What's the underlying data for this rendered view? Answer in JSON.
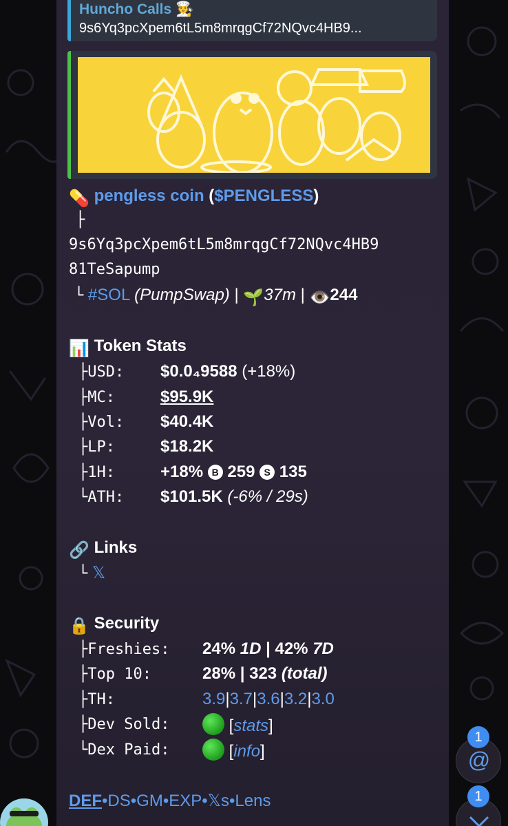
{
  "reply": {
    "sender": "Huncho Calls",
    "sender_emoji": "🧑‍🍳",
    "text": "9s6Yq3pcXpem6tL5m8mrqgCf72NQvc4HB9..."
  },
  "token": {
    "pill_emoji": "💊",
    "name": "pengless coin",
    "paren_open": " (",
    "ticker": "$PENGLESS",
    "paren_close": ")",
    "branch1": "├",
    "address_line1": "9s6Yq3pcXpem6tL5m8mrqgCf72NQvc4HB9",
    "address_line2": "81TeSapump",
    "branch2": "└",
    "chain": "#SOL",
    "dex": "(PumpSwap)",
    "sep": "|",
    "age_emoji": "🌱",
    "age": "37m",
    "views_emoji": "👁️",
    "views": "244"
  },
  "stats": {
    "emoji": "📊",
    "title": "Token Stats",
    "usd_label": "├USD:",
    "usd_value": "$0.0₄9588",
    "usd_change": "(+18%)",
    "mc_label": "├MC:",
    "mc_value": "$95.9K",
    "vol_label": "├Vol:",
    "vol_value": "$40.4K",
    "lp_label": "├LP:",
    "lp_value": "$18.2K",
    "h1_label": "├1H:",
    "h1_change": "+18%",
    "h1_buy_icon": "B",
    "h1_buys": "259",
    "h1_sell_icon": "S",
    "h1_sells": "135",
    "ath_label": "└ATH:",
    "ath_value": "$101.5K",
    "ath_detail": "(-6% / 29s)"
  },
  "links": {
    "emoji": "🔗",
    "title": "Links",
    "branch": "└",
    "x_link": "𝕏"
  },
  "security": {
    "emoji": "🔒",
    "title": "Security",
    "freshies_label": "├Freshies:",
    "freshies_1d": "24%",
    "freshies_1d_unit": "1D",
    "freshies_sep": "|",
    "freshies_7d": "42%",
    "freshies_7d_unit": "7D",
    "top10_label": "├Top 10:",
    "top10_pct": "28%",
    "top10_sep": "|",
    "top10_count": "323",
    "top10_note": "(total)",
    "th_label": "├TH:",
    "th_values": [
      "3.9",
      "3.7",
      "3.6",
      "3.2",
      "3.0"
    ],
    "th_sep": "|",
    "dev_label": "├Dev Sold:",
    "dev_link": "stats",
    "dex_label": "└Dex Paid:",
    "dex_link": "info",
    "bracket_open": "[",
    "bracket_close": "]"
  },
  "footer_links": {
    "def": "DEF",
    "ds": "DS",
    "gm": "GM",
    "exp": "EXP",
    "xs": "𝕏s",
    "lens": "Lens",
    "dot": "•"
  },
  "fabs": {
    "mention_badge": "1",
    "mention_icon": "@",
    "down_badge": "1"
  },
  "colors": {
    "link": "#5e9bea",
    "reply_accent": "#3aa7d8",
    "preview_accent": "#4fc04a",
    "banner": "#f8d33a",
    "badge": "#3f8df0"
  }
}
